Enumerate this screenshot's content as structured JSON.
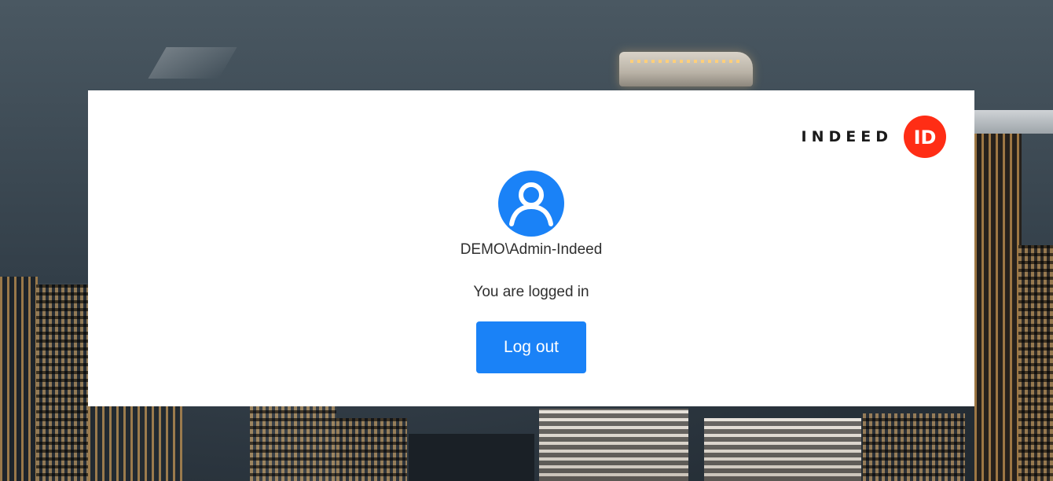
{
  "brand": {
    "wordmark": "INDEED",
    "badge_text": "ID",
    "badge_color": "#ff2d15"
  },
  "user": {
    "account": "DEMO\\Admin-Indeed",
    "avatar_icon": "user-circle-icon",
    "avatar_color": "#1a82f7"
  },
  "session": {
    "status_text": "You are logged in",
    "logout_label": "Log out",
    "logout_color": "#1a82f7"
  }
}
